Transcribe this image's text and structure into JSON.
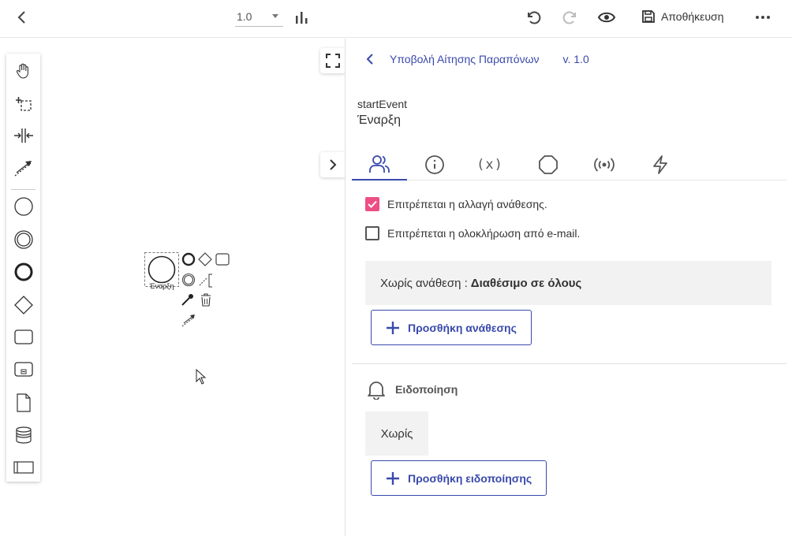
{
  "toolbar": {
    "back_icon": "chevron-left-icon",
    "version_value": "1.0",
    "save_label": "Αποθήκευση"
  },
  "canvas": {
    "start_event_label": "Έναρξη"
  },
  "panel": {
    "process_title": "Υποβολή Αίτησης Παραπόνων",
    "version": "v. 1.0",
    "element_type": "startEvent",
    "element_name": "Έναρξη",
    "tabs": [
      {
        "icon": "users-icon",
        "active": true
      },
      {
        "icon": "info-icon",
        "active": false
      },
      {
        "label": "(x)",
        "icon": "variables-icon",
        "active": false
      },
      {
        "icon": "octagon-icon",
        "active": false
      },
      {
        "icon": "broadcast-icon",
        "active": false
      },
      {
        "icon": "lightning-icon",
        "active": false
      }
    ],
    "allow_reassign_label": "Επιτρέπεται η αλλαγή ανάθεσης.",
    "allow_reassign_checked": true,
    "allow_email_complete_label": "Επιτρέπεται η ολοκλήρωση από e-mail.",
    "allow_email_complete_checked": false,
    "assignment_prefix": "Χωρίς ανάθεση :",
    "assignment_value": "Διαθέσιμο σε όλους",
    "add_assignment_label": "Προσθήκη ανάθεσης",
    "notification_heading": "Ειδοποίηση",
    "notification_value": "Χωρίς",
    "add_notification_label": "Προσθήκη ειδοποίησης"
  },
  "colors": {
    "accent": "#3949ab",
    "checkbox_checked": "#e91e63",
    "box_bg": "#f2f2f2"
  }
}
